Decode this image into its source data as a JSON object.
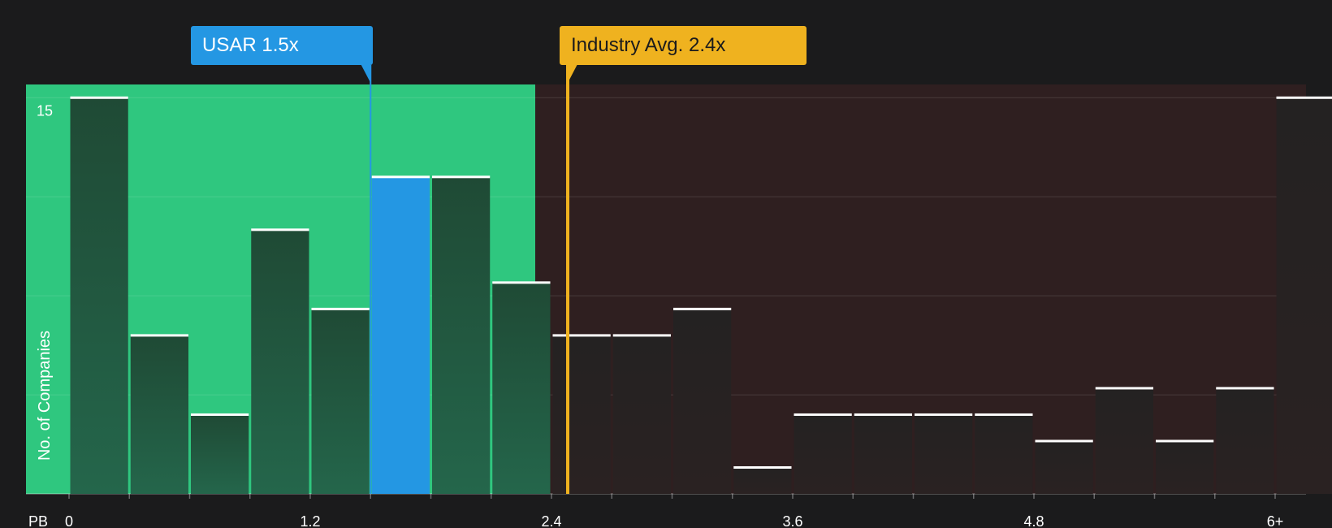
{
  "chart_data": {
    "type": "bar",
    "title": "",
    "xlabel": "PB",
    "ylabel": "No. of Companies",
    "x_ticks": [
      "0",
      "1.2",
      "2.4",
      "3.6",
      "4.8",
      "6+"
    ],
    "y_ticks": [
      "15"
    ],
    "ylim": [
      0,
      15.5
    ],
    "grid": true,
    "bins": [
      {
        "from": 0.0,
        "to": 0.3,
        "value": 15
      },
      {
        "from": 0.3,
        "to": 0.6,
        "value": 6
      },
      {
        "from": 0.6,
        "to": 0.9,
        "value": 3
      },
      {
        "from": 0.9,
        "to": 1.2,
        "value": 10
      },
      {
        "from": 1.2,
        "to": 1.5,
        "value": 7
      },
      {
        "from": 1.5,
        "to": 1.8,
        "value": 12,
        "highlight": true
      },
      {
        "from": 1.8,
        "to": 2.1,
        "value": 12
      },
      {
        "from": 2.1,
        "to": 2.4,
        "value": 8
      },
      {
        "from": 2.4,
        "to": 2.7,
        "value": 6
      },
      {
        "from": 2.7,
        "to": 3.0,
        "value": 6
      },
      {
        "from": 3.0,
        "to": 3.3,
        "value": 7
      },
      {
        "from": 3.3,
        "to": 3.6,
        "value": 1
      },
      {
        "from": 3.6,
        "to": 3.9,
        "value": 3
      },
      {
        "from": 3.9,
        "to": 4.2,
        "value": 3
      },
      {
        "from": 4.2,
        "to": 4.5,
        "value": 3
      },
      {
        "from": 4.5,
        "to": 4.8,
        "value": 3
      },
      {
        "from": 4.8,
        "to": 5.1,
        "value": 2
      },
      {
        "from": 5.1,
        "to": 5.4,
        "value": 4
      },
      {
        "from": 5.4,
        "to": 5.7,
        "value": 2
      },
      {
        "from": 5.7,
        "to": 6.0,
        "value": 4
      },
      {
        "from": 6.0,
        "to": 6.3,
        "value": 15
      }
    ],
    "markers": [
      {
        "key": "company",
        "label": "USAR 1.5x",
        "value": 1.5,
        "color": "#2497e3"
      },
      {
        "key": "industry",
        "label": "Industry Avg. 2.4x",
        "value": 2.4,
        "color": "#efb21f"
      }
    ],
    "regions": {
      "undervalued_color": "#2fc77f",
      "overvalued_color": "#2f1f20",
      "boundary": 2.4
    }
  }
}
